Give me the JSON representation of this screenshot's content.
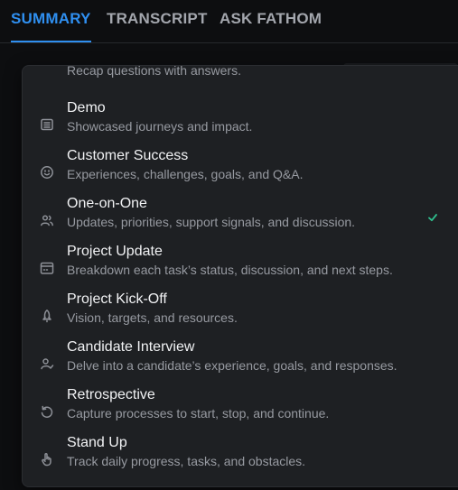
{
  "tabs": [
    {
      "label": "SUMMARY",
      "active": true
    },
    {
      "label": "TRANSCRIPT",
      "active": false
    },
    {
      "label": "ASK FATHOM",
      "active": false
    }
  ],
  "accent_color": "#2f8ff0",
  "check_color": "#2fbf8e",
  "template_menu": {
    "partial_item_desc": "Recap questions with answers.",
    "selected": "One-on-One",
    "items": [
      {
        "icon": "list-icon",
        "title": "Demo",
        "desc": "Showcased journeys and impact."
      },
      {
        "icon": "smiley-icon",
        "title": "Customer Success",
        "desc": "Experiences, challenges, goals, and Q&A."
      },
      {
        "icon": "users-icon",
        "title": "One-on-One",
        "desc": "Updates, priorities, support signals, and discussion."
      },
      {
        "icon": "calendar-icon",
        "title": "Project Update",
        "desc": "Breakdown each task’s status, discussion, and next steps."
      },
      {
        "icon": "rocket-icon",
        "title": "Project Kick-Off",
        "desc": "Vision, targets, and resources."
      },
      {
        "icon": "user-check-icon",
        "title": "Candidate Interview",
        "desc": "Delve into a candidate’s experience, goals, and responses."
      },
      {
        "icon": "rotate-icon",
        "title": "Retrospective",
        "desc": "Capture processes to start, stop, and continue."
      },
      {
        "icon": "hand-pointer-icon",
        "title": "Stand Up",
        "desc": "Track daily progress, tasks, and obstacles."
      }
    ]
  }
}
